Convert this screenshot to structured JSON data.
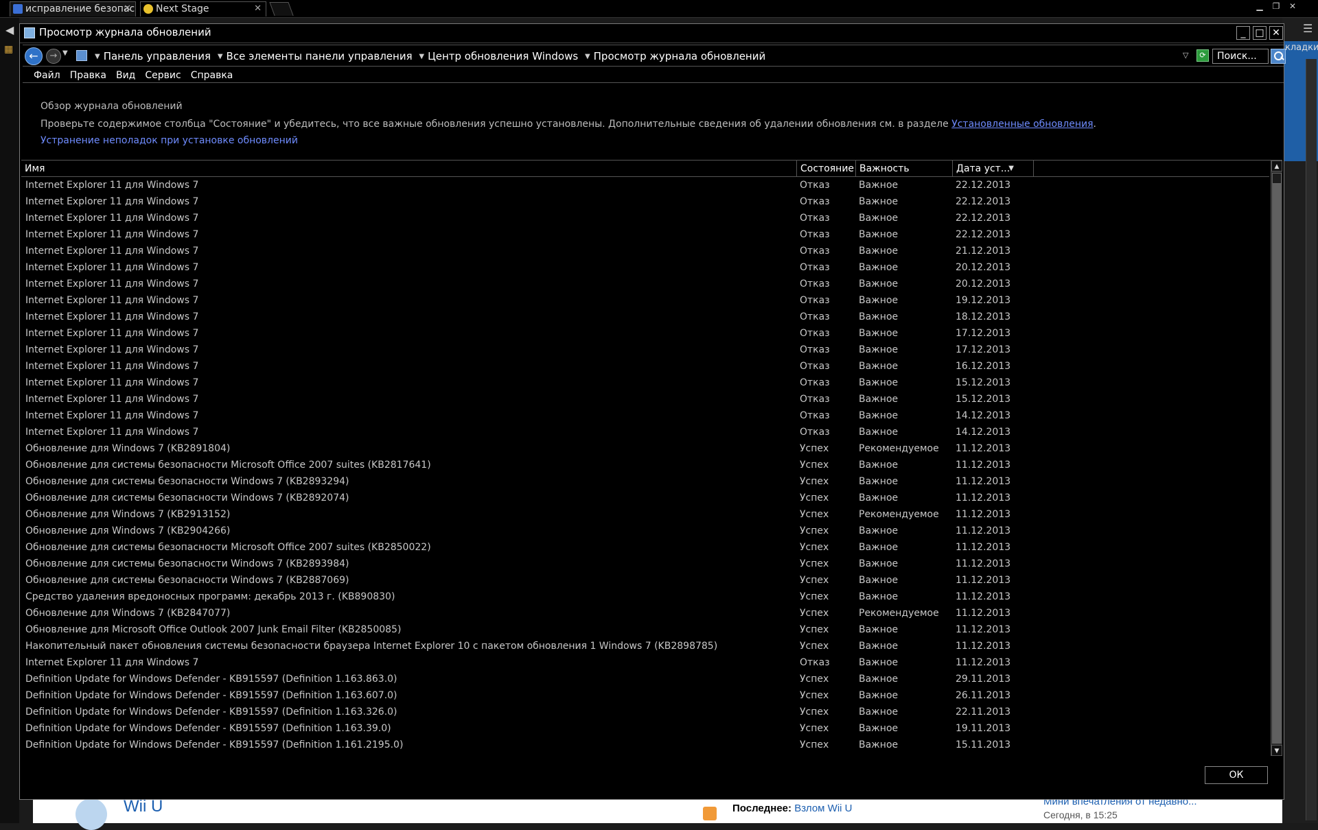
{
  "browser": {
    "tabs": [
      {
        "label": "исправление безопасн",
        "favicon_color": "#3b6fd6"
      },
      {
        "label": "Next Stage",
        "favicon_color": "#e8c12c"
      }
    ],
    "right_bookmarks_label": "кладки"
  },
  "background_page": {
    "wii_title": "Wii U",
    "last_label": "Последнее:",
    "last_link": "Взлом Wii U",
    "mini_link": "Мини впечатления от недавно...",
    "today": "Сегодня, в 15:25"
  },
  "window": {
    "title": "Просмотр журнала обновлений",
    "breadcrumbs": [
      "Панель управления",
      "Все элементы панели управления",
      "Центр обновления Windows",
      "Просмотр журнала обновлений"
    ],
    "search_value": "Поиск...",
    "menu": [
      "Файл",
      "Правка",
      "Вид",
      "Сервис",
      "Справка"
    ],
    "overview_title": "Обзор журнала обновлений",
    "description": "Проверьте содержимое столбца \"Состояние\" и убедитесь, что все важные обновления успешно установлены. Дополнительные сведения об удалении обновления см. в разделе ",
    "installed_updates_link": "Установленные обновления",
    "description_end": ".",
    "troubleshoot_link": "Устранение неполадок при установке обновлений",
    "ok_label": "ОК"
  },
  "table": {
    "columns": [
      "Имя",
      "Состояние",
      "Важность",
      "Дата уст..."
    ],
    "rows": [
      {
        "name": "Internet Explorer 11 для Windows 7",
        "status": "Отказ",
        "importance": "Важное",
        "date": "22.12.2013"
      },
      {
        "name": "Internet Explorer 11 для Windows 7",
        "status": "Отказ",
        "importance": "Важное",
        "date": "22.12.2013"
      },
      {
        "name": "Internet Explorer 11 для Windows 7",
        "status": "Отказ",
        "importance": "Важное",
        "date": "22.12.2013"
      },
      {
        "name": "Internet Explorer 11 для Windows 7",
        "status": "Отказ",
        "importance": "Важное",
        "date": "22.12.2013"
      },
      {
        "name": "Internet Explorer 11 для Windows 7",
        "status": "Отказ",
        "importance": "Важное",
        "date": "21.12.2013"
      },
      {
        "name": "Internet Explorer 11 для Windows 7",
        "status": "Отказ",
        "importance": "Важное",
        "date": "20.12.2013"
      },
      {
        "name": "Internet Explorer 11 для Windows 7",
        "status": "Отказ",
        "importance": "Важное",
        "date": "20.12.2013"
      },
      {
        "name": "Internet Explorer 11 для Windows 7",
        "status": "Отказ",
        "importance": "Важное",
        "date": "19.12.2013"
      },
      {
        "name": "Internet Explorer 11 для Windows 7",
        "status": "Отказ",
        "importance": "Важное",
        "date": "18.12.2013"
      },
      {
        "name": "Internet Explorer 11 для Windows 7",
        "status": "Отказ",
        "importance": "Важное",
        "date": "17.12.2013"
      },
      {
        "name": "Internet Explorer 11 для Windows 7",
        "status": "Отказ",
        "importance": "Важное",
        "date": "17.12.2013"
      },
      {
        "name": "Internet Explorer 11 для Windows 7",
        "status": "Отказ",
        "importance": "Важное",
        "date": "16.12.2013"
      },
      {
        "name": "Internet Explorer 11 для Windows 7",
        "status": "Отказ",
        "importance": "Важное",
        "date": "15.12.2013"
      },
      {
        "name": "Internet Explorer 11 для Windows 7",
        "status": "Отказ",
        "importance": "Важное",
        "date": "15.12.2013"
      },
      {
        "name": "Internet Explorer 11 для Windows 7",
        "status": "Отказ",
        "importance": "Важное",
        "date": "14.12.2013"
      },
      {
        "name": "Internet Explorer 11 для Windows 7",
        "status": "Отказ",
        "importance": "Важное",
        "date": "14.12.2013"
      },
      {
        "name": "Обновление для Windows 7 (KB2891804)",
        "status": "Успех",
        "importance": "Рекомендуемое",
        "date": "11.12.2013"
      },
      {
        "name": "Обновление для системы безопасности Microsoft Office 2007 suites (KB2817641)",
        "status": "Успех",
        "importance": "Важное",
        "date": "11.12.2013"
      },
      {
        "name": "Обновление для системы безопасности Windows 7 (KB2893294)",
        "status": "Успех",
        "importance": "Важное",
        "date": "11.12.2013"
      },
      {
        "name": "Обновление для системы безопасности Windows 7 (KB2892074)",
        "status": "Успех",
        "importance": "Важное",
        "date": "11.12.2013"
      },
      {
        "name": "Обновление для Windows 7 (KB2913152)",
        "status": "Успех",
        "importance": "Рекомендуемое",
        "date": "11.12.2013"
      },
      {
        "name": "Обновление для Windows 7 (KB2904266)",
        "status": "Успех",
        "importance": "Важное",
        "date": "11.12.2013"
      },
      {
        "name": "Обновление для системы безопасности Microsoft Office 2007 suites (KB2850022)",
        "status": "Успех",
        "importance": "Важное",
        "date": "11.12.2013"
      },
      {
        "name": "Обновление для системы безопасности Windows 7 (KB2893984)",
        "status": "Успех",
        "importance": "Важное",
        "date": "11.12.2013"
      },
      {
        "name": "Обновление для системы безопасности Windows 7 (KB2887069)",
        "status": "Успех",
        "importance": "Важное",
        "date": "11.12.2013"
      },
      {
        "name": "Средство удаления вредоносных программ: декабрь 2013 г. (KB890830)",
        "status": "Успех",
        "importance": "Важное",
        "date": "11.12.2013"
      },
      {
        "name": "Обновление для Windows 7 (KB2847077)",
        "status": "Успех",
        "importance": "Рекомендуемое",
        "date": "11.12.2013"
      },
      {
        "name": "Обновление для Microsoft Office Outlook 2007 Junk Email Filter (KB2850085)",
        "status": "Успех",
        "importance": "Важное",
        "date": "11.12.2013"
      },
      {
        "name": "Накопительный пакет обновления системы безопасности браузера Internet Explorer 10 с пакетом обновления 1 Windows 7 (KB2898785)",
        "status": "Успех",
        "importance": "Важное",
        "date": "11.12.2013"
      },
      {
        "name": "Internet Explorer 11 для Windows 7",
        "status": "Отказ",
        "importance": "Важное",
        "date": "11.12.2013"
      },
      {
        "name": "Definition Update for Windows Defender - KB915597 (Definition 1.163.863.0)",
        "status": "Успех",
        "importance": "Важное",
        "date": "29.11.2013"
      },
      {
        "name": "Definition Update for Windows Defender - KB915597 (Definition 1.163.607.0)",
        "status": "Успех",
        "importance": "Важное",
        "date": "26.11.2013"
      },
      {
        "name": "Definition Update for Windows Defender - KB915597 (Definition 1.163.326.0)",
        "status": "Успех",
        "importance": "Важное",
        "date": "22.11.2013"
      },
      {
        "name": "Definition Update for Windows Defender - KB915597 (Definition 1.163.39.0)",
        "status": "Успех",
        "importance": "Важное",
        "date": "19.11.2013"
      },
      {
        "name": "Definition Update for Windows Defender - KB915597 (Definition 1.161.2195.0)",
        "status": "Успех",
        "importance": "Важное",
        "date": "15.11.2013"
      }
    ]
  }
}
